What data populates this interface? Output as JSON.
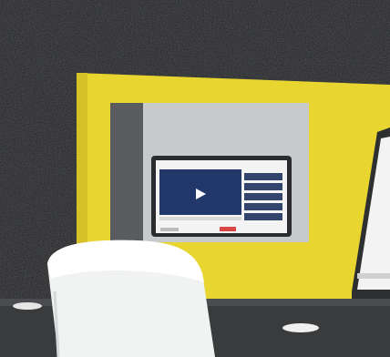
{
  "scene": {
    "colors": {
      "wall": "#1f2022",
      "partition": "#e8d530",
      "partition_shadow": "#c9b522",
      "desk": "#3a3b3d",
      "chair": "#f1f2f2",
      "screen_bg": "#c8c9cb",
      "laptop": "#2b2c2f"
    },
    "video_player": {
      "play_icon": "play-icon"
    }
  }
}
